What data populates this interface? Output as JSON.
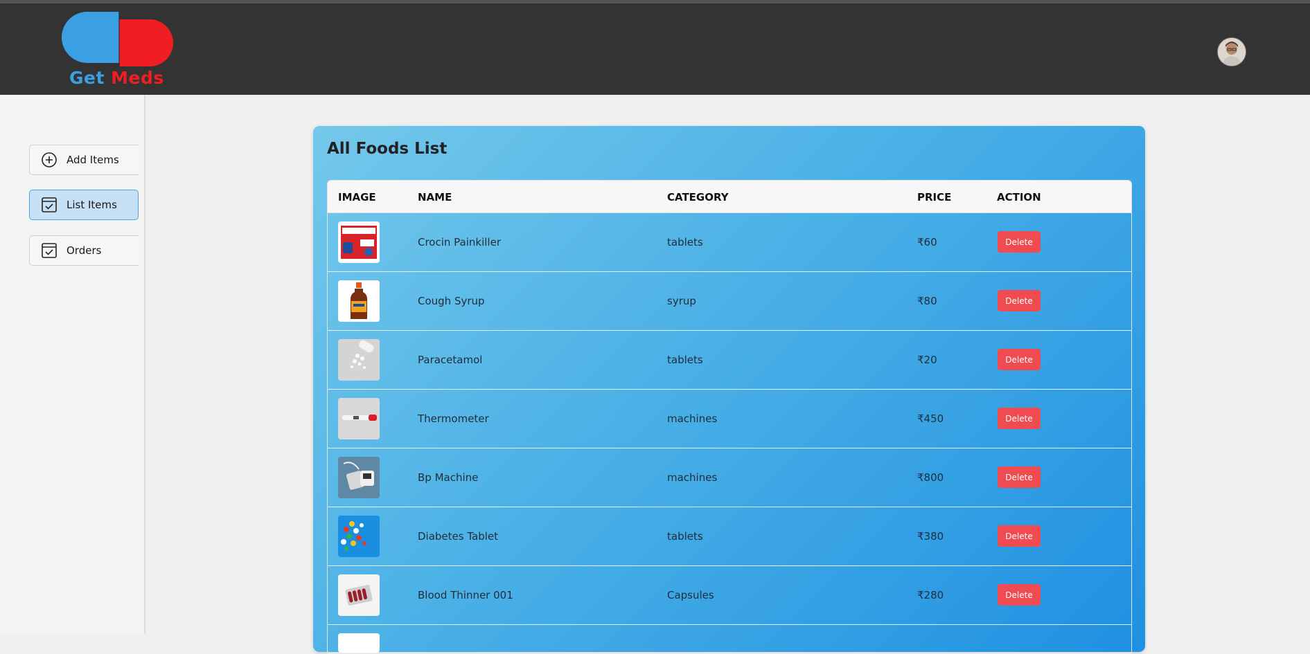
{
  "brand": {
    "word1": "Get",
    "word2": "Meds",
    "primary_color": "#3b9fe4",
    "accent_color": "#f01e23"
  },
  "sidebar": {
    "items": [
      {
        "label": "Add Items",
        "icon": "plus-circle-icon",
        "active": false
      },
      {
        "label": "List Items",
        "icon": "checklist-icon",
        "active": true
      },
      {
        "label": "Orders",
        "icon": "checklist-icon",
        "active": false
      }
    ]
  },
  "main": {
    "title": "All Foods List",
    "columns": [
      "IMAGE",
      "NAME",
      "CATEGORY",
      "PRICE",
      "ACTION"
    ],
    "rows": [
      {
        "image": "crocin-box-image",
        "name": "Crocin Painkiller",
        "category": "tablets",
        "price": "₹60",
        "action": "Delete"
      },
      {
        "image": "syrup-bottle-image",
        "name": "Cough Syrup",
        "category": "syrup",
        "price": "₹80",
        "action": "Delete"
      },
      {
        "image": "pills-image",
        "name": "Paracetamol",
        "category": "tablets",
        "price": "₹20",
        "action": "Delete"
      },
      {
        "image": "thermometer-image",
        "name": "Thermometer",
        "category": "machines",
        "price": "₹450",
        "action": "Delete"
      },
      {
        "image": "bp-machine-image",
        "name": "Bp Machine",
        "category": "machines",
        "price": "₹800",
        "action": "Delete"
      },
      {
        "image": "colorful-pills-image",
        "name": "Diabetes Tablet",
        "category": "tablets",
        "price": "₹380",
        "action": "Delete"
      },
      {
        "image": "blister-pack-image",
        "name": "Blood Thinner 001",
        "category": "Capsules",
        "price": "₹280",
        "action": "Delete"
      }
    ]
  },
  "colors": {
    "delete_button": "#ef4b50",
    "active_sidebar": "#c7e0f6",
    "card_gradient_start": "#74c8eb",
    "card_gradient_end": "#1f90e2"
  }
}
